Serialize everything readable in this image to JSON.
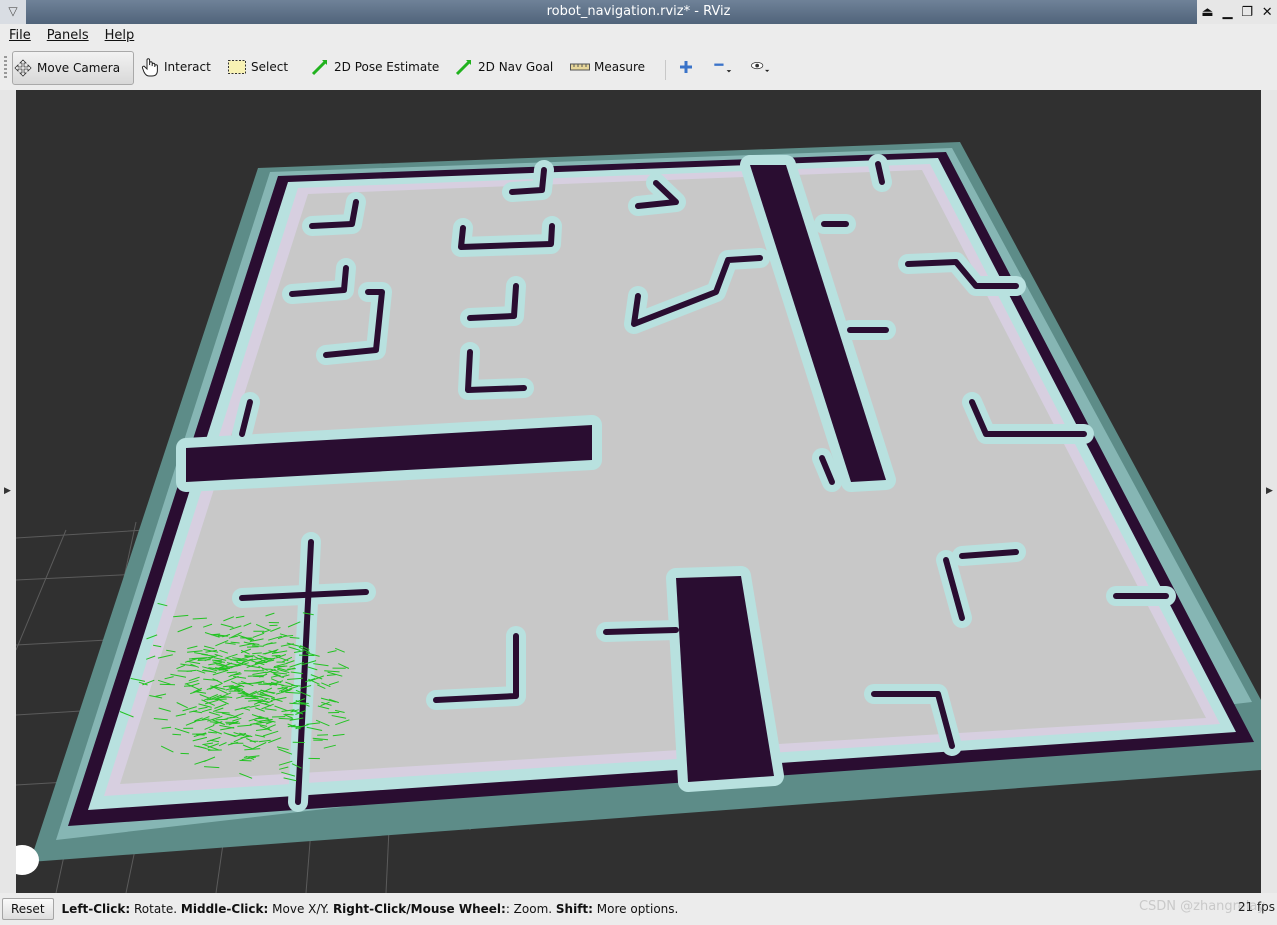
{
  "window": {
    "title": "robot_navigation.rviz* - RViz",
    "controls": [
      "⏏",
      "▁",
      "❐",
      "✕"
    ]
  },
  "menu": [
    "File",
    "Panels",
    "Help"
  ],
  "toolbar": {
    "move_camera": "Move Camera",
    "interact": "Interact",
    "select": "Select",
    "pose_estimate": "2D Pose Estimate",
    "nav_goal": "2D Nav Goal",
    "measure": "Measure"
  },
  "status": {
    "reset": "Reset",
    "left_click_key": "Left-Click:",
    "left_click_desc": " Rotate. ",
    "middle_click_key": "Middle-Click:",
    "middle_click_desc": " Move X/Y. ",
    "right_click_key": "Right-Click/Mouse Wheel:",
    "right_click_desc": ": Zoom. ",
    "shift_key": "Shift:",
    "shift_desc": " More options.",
    "fps": "21 fps",
    "watermark": "CSDN @zhangrelay"
  },
  "colors": {
    "map_free": "#c7c7c7",
    "obstacle": "#2a0d31",
    "inflation": "#b8e1df",
    "unknown_border": "#5f8f8b",
    "particles": "#22c322",
    "background": "#303030"
  }
}
